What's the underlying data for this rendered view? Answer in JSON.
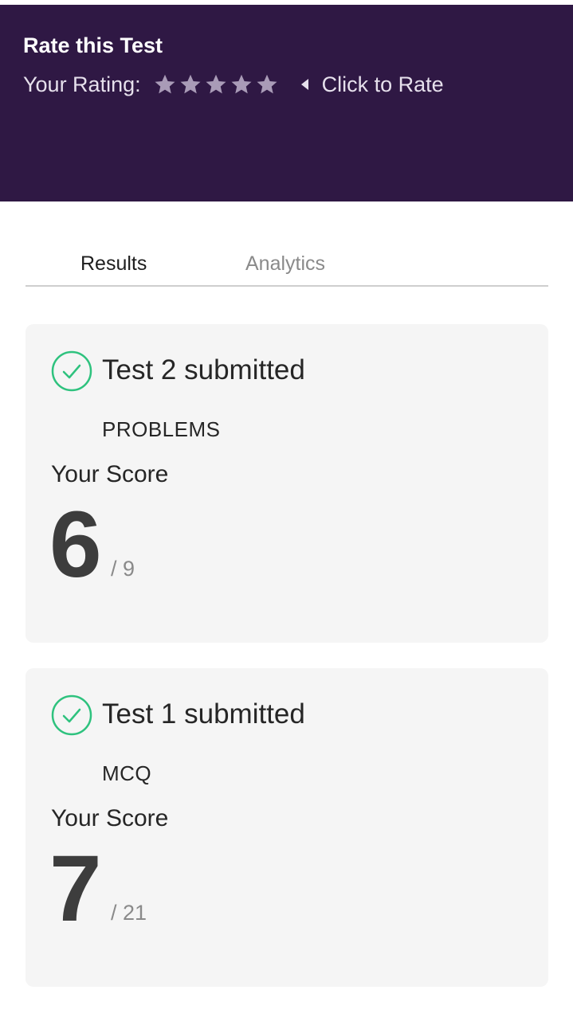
{
  "header": {
    "title": "Rate this Test",
    "rating_label": "Your Rating:",
    "stars_total": 5,
    "stars_filled": 0,
    "click_to_rate": "Click to Rate",
    "background_color": "#2f1844",
    "star_color": "#a99bb7"
  },
  "tabs": [
    {
      "label": "Results",
      "active": true
    },
    {
      "label": "Analytics",
      "active": false
    }
  ],
  "results": [
    {
      "title": "Test 2 submitted",
      "type": "PROBLEMS",
      "score_label": "Your Score",
      "score": "6",
      "total": "/ 9",
      "status_icon": "check-circle-icon",
      "status_color": "#2ec27e"
    },
    {
      "title": "Test 1 submitted",
      "type": "MCQ",
      "score_label": "Your Score",
      "score": "7",
      "total": "/ 21",
      "status_icon": "check-circle-icon",
      "status_color": "#2ec27e"
    }
  ]
}
